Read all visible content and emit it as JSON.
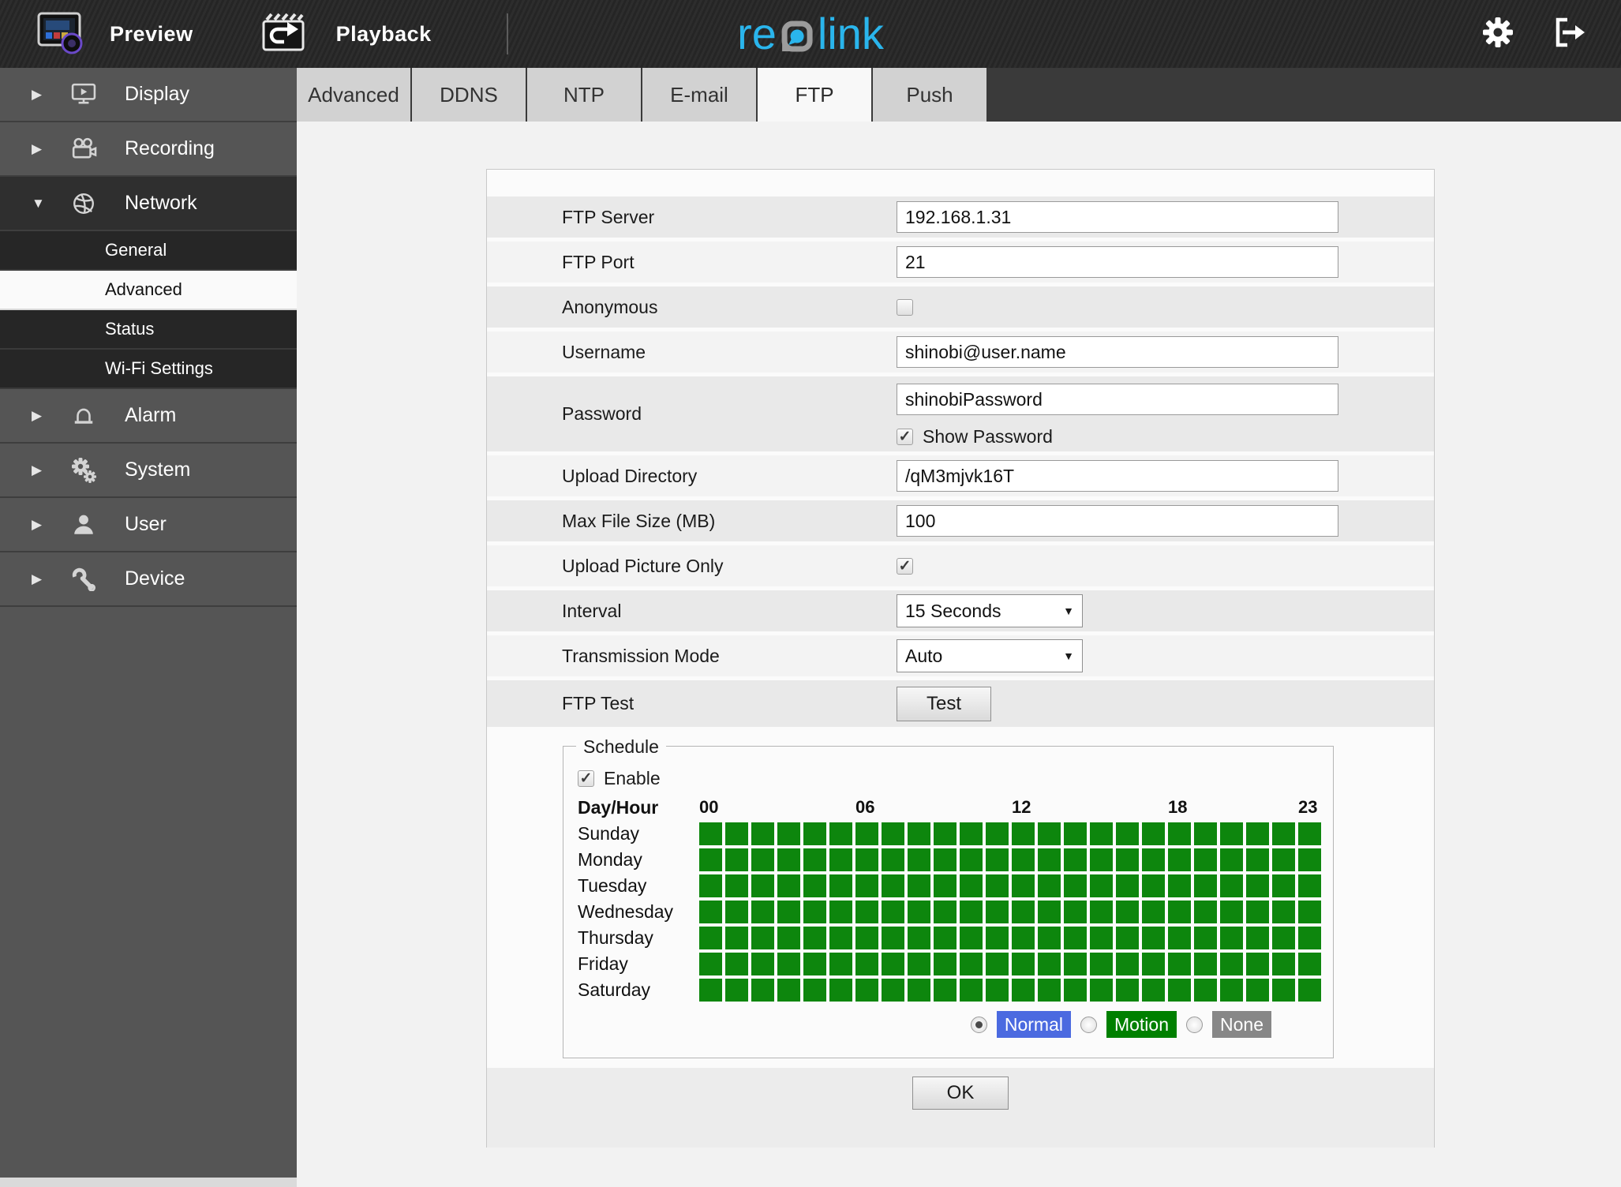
{
  "topbar": {
    "preview_label": "Preview",
    "playback_label": "Playback",
    "logo": {
      "part1": "re",
      "part2": "link"
    }
  },
  "sidebar": {
    "items": [
      {
        "label": "Display",
        "icon": "display-icon",
        "expanded": false
      },
      {
        "label": "Recording",
        "icon": "recording-icon",
        "expanded": false
      },
      {
        "label": "Network",
        "icon": "network-icon",
        "expanded": true
      },
      {
        "label": "Alarm",
        "icon": "alarm-icon",
        "expanded": false
      },
      {
        "label": "System",
        "icon": "system-icon",
        "expanded": false
      },
      {
        "label": "User",
        "icon": "user-icon",
        "expanded": false
      },
      {
        "label": "Device",
        "icon": "device-icon",
        "expanded": false
      }
    ],
    "network_submenu": [
      {
        "label": "General",
        "active": false
      },
      {
        "label": "Advanced",
        "active": true
      },
      {
        "label": "Status",
        "active": false
      },
      {
        "label": "Wi-Fi Settings",
        "active": false
      }
    ]
  },
  "tabs": {
    "items": [
      "Advanced",
      "DDNS",
      "NTP",
      "E-mail",
      "FTP",
      "Push"
    ],
    "active": "FTP"
  },
  "form": {
    "ftp_server": {
      "label": "FTP Server",
      "value": "192.168.1.31"
    },
    "ftp_port": {
      "label": "FTP Port",
      "value": "21"
    },
    "anonymous": {
      "label": "Anonymous",
      "checked": false
    },
    "username": {
      "label": "Username",
      "value": "shinobi@user.name"
    },
    "password": {
      "label": "Password",
      "value": "shinobiPassword",
      "show_password_label": "Show Password",
      "show_password_checked": true
    },
    "upload_directory": {
      "label": "Upload Directory",
      "value": "/qM3mjvk16T"
    },
    "max_file_size": {
      "label": "Max File Size (MB)",
      "value": "100"
    },
    "upload_picture_only": {
      "label": "Upload Picture Only",
      "checked": true
    },
    "interval": {
      "label": "Interval",
      "value": "15 Seconds"
    },
    "transmission_mode": {
      "label": "Transmission Mode",
      "value": "Auto"
    },
    "ftp_test": {
      "label": "FTP Test",
      "button_label": "Test"
    }
  },
  "schedule": {
    "legend": "Schedule",
    "enable_label": "Enable",
    "enable_checked": true,
    "day_hour_label": "Day/Hour",
    "hour_labels": [
      {
        "text": "00",
        "col": 0
      },
      {
        "text": "06",
        "col": 6
      },
      {
        "text": "12",
        "col": 12
      },
      {
        "text": "18",
        "col": 18
      },
      {
        "text": "23",
        "col": 23
      }
    ],
    "days": [
      "Sunday",
      "Monday",
      "Tuesday",
      "Wednesday",
      "Thursday",
      "Friday",
      "Saturday"
    ],
    "columns": 24,
    "all_cells_state": "motion",
    "cell_color": "#0d860d",
    "modes": [
      {
        "label": "Normal",
        "color": "#4b6ae0",
        "selected": true
      },
      {
        "label": "Motion",
        "color": "#008000",
        "selected": false
      },
      {
        "label": "None",
        "color": "#878787",
        "selected": false
      }
    ]
  },
  "ok_label": "OK",
  "colors": {
    "accent_cyan": "#2ab5ec",
    "topbar_bg": "#2a2a2a",
    "sidebar_bg": "#555555",
    "schedule_green": "#0d860d"
  },
  "icons": [
    "preview-icon",
    "playback-icon",
    "reolink-logo",
    "gear-icon",
    "logout-icon",
    "display-icon",
    "recording-icon",
    "network-icon",
    "alarm-icon",
    "system-icon",
    "user-icon",
    "device-icon",
    "chevron-right-icon",
    "chevron-down-icon",
    "select-arrow-icon"
  ]
}
